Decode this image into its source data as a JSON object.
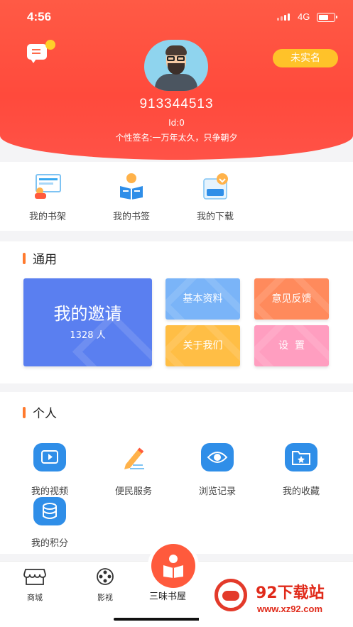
{
  "status_bar": {
    "time": "4:56",
    "network": "4G",
    "battery_level": 0.7
  },
  "profile": {
    "user_number": "913344513",
    "user_id": "Id:0",
    "signature": "个性签名:一万年太久，只争朝夕",
    "realname_button": "未实名"
  },
  "quick_actions": [
    {
      "label": "我的书架",
      "icon": "bookshelf-icon"
    },
    {
      "label": "我的书签",
      "icon": "bookmark-reader-icon"
    },
    {
      "label": "我的下载",
      "icon": "download-icon"
    }
  ],
  "general": {
    "title": "通用",
    "invite": {
      "title": "我的邀请",
      "count": "1328 人"
    },
    "tiles": [
      {
        "label": "基本资料",
        "color": "#7ab4f8"
      },
      {
        "label": "意见反馈",
        "color": "#ff8a5c"
      },
      {
        "label": "关于我们",
        "color": "#ffbe45"
      },
      {
        "label": "设  置",
        "color": "#ff9ec0"
      }
    ],
    "invite_color": "#5a7ff0"
  },
  "personal": {
    "title": "个人",
    "items": [
      {
        "label": "我的视频",
        "icon": "video-icon"
      },
      {
        "label": "便民服务",
        "icon": "pencil-icon"
      },
      {
        "label": "浏览记录",
        "icon": "eye-icon"
      },
      {
        "label": "我的收藏",
        "icon": "favorite-folder-icon"
      },
      {
        "label": "我的积分",
        "icon": "coins-icon"
      }
    ]
  },
  "tabbar": {
    "tabs": [
      {
        "label": "商城",
        "icon": "store-icon"
      },
      {
        "label": "影视",
        "icon": "film-reel-icon"
      }
    ],
    "center_label": "三味书屋",
    "center_icon": "reading-icon"
  },
  "watermark": {
    "name": "92下载站",
    "url": "www.xz92.com"
  },
  "colors": {
    "header_red": "#ff4f40",
    "accent_orange": "#ff7a2e",
    "realname_yellow": "#ffc229"
  }
}
